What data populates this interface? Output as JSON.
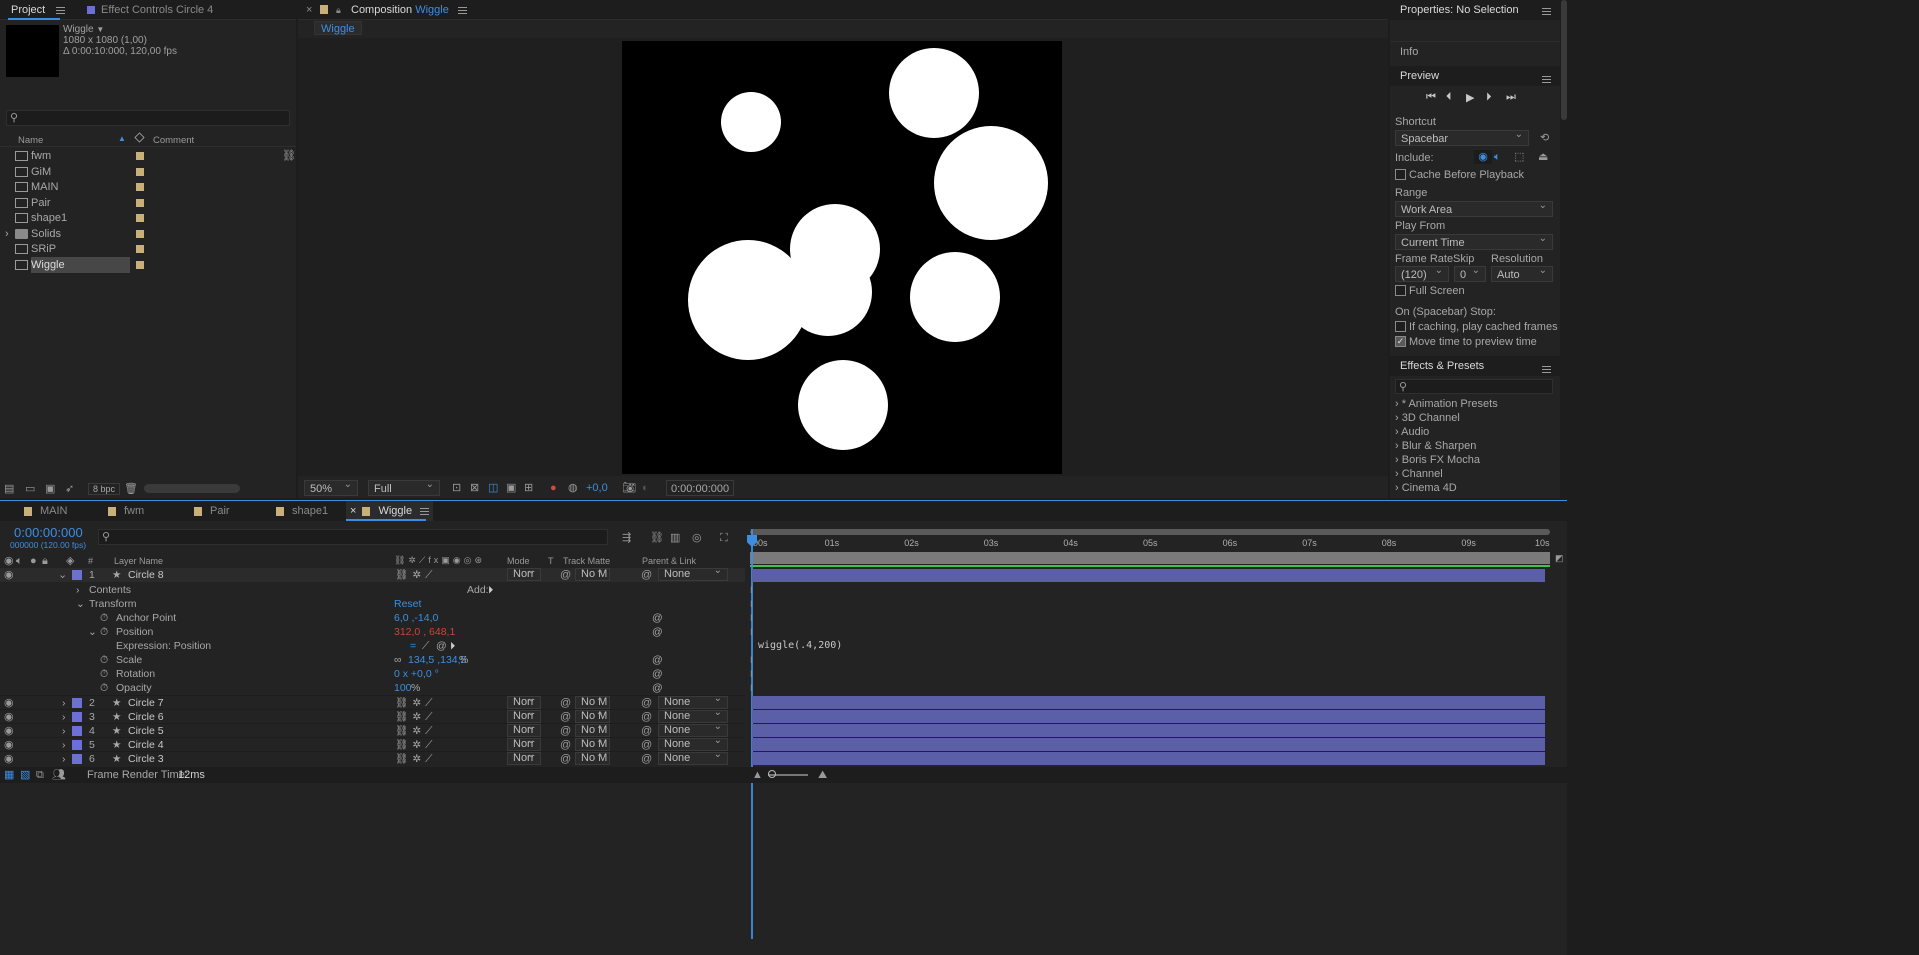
{
  "project": {
    "tab_project": "Project",
    "tab_effect_controls": "Effect Controls",
    "effect_target": "Circle 4",
    "comp_name": "Wiggle",
    "comp_size": "1080 x 1080 (1,00)",
    "comp_duration": "Δ 0:00:10:000, 120,00 fps",
    "col_name": "Name",
    "col_comment": "Comment",
    "items": [
      {
        "name": "fwm"
      },
      {
        "name": "GiM"
      },
      {
        "name": "MAIN"
      },
      {
        "name": "Pair"
      },
      {
        "name": "shape1"
      },
      {
        "name": "Solids"
      },
      {
        "name": "SRiP"
      },
      {
        "name": "Wiggle"
      }
    ],
    "bpc": "8 bpc"
  },
  "composition": {
    "tab_prefix": "Composition",
    "tab_name": "Wiggle",
    "sub_tab": "Wiggle",
    "zoom": "50%",
    "quality": "Full",
    "exposure": "+0,0",
    "timecode": "0:00:00:000"
  },
  "right": {
    "properties": "Properties: No Selection",
    "info": "Info",
    "preview": "Preview",
    "shortcut_label": "Shortcut",
    "shortcut_value": "Spacebar",
    "include_label": "Include:",
    "cache_before": "Cache Before Playback",
    "range_label": "Range",
    "range_value": "Work Area",
    "play_from_label": "Play From",
    "play_from_value": "Current Time",
    "frame_rate_label": "Frame Rate",
    "skip_label": "Skip",
    "resolution_label": "Resolution",
    "frame_rate_value": "(120)",
    "skip_value": "0",
    "resolution_value": "Auto",
    "full_screen": "Full Screen",
    "on_stop": "On (Spacebar) Stop:",
    "if_caching": "If caching, play cached frames",
    "move_time": "Move time to preview time",
    "effects_presets": "Effects & Presets",
    "effects": [
      "* Animation Presets",
      "3D Channel",
      "Audio",
      "Blur & Sharpen",
      "Boris FX Mocha",
      "Channel",
      "Cinema 4D"
    ]
  },
  "timeline": {
    "tabs": [
      "MAIN",
      "fwm",
      "Pair",
      "shape1",
      "Wiggle"
    ],
    "time": "0:00:00:000",
    "frames": "000000 (120.00 fps)",
    "col_layer_name": "Layer Name",
    "col_mode": "Mode",
    "col_t": "T",
    "col_track_matte": "Track Matte",
    "col_parent": "Parent & Link",
    "ruler": [
      "00s",
      "01s",
      "02s",
      "03s",
      "04s",
      "05s",
      "06s",
      "07s",
      "08s",
      "09s",
      "10s"
    ],
    "layer1": {
      "num": "1",
      "name": "Circle 8",
      "mode": "Norr",
      "matte": "No M",
      "parent": "None"
    },
    "contents": "Contents",
    "add": "Add:",
    "transform": "Transform",
    "reset": "Reset",
    "anchor_label": "Anchor Point",
    "anchor_value": "6,0 ,-14,0",
    "position_label": "Position",
    "position_value": "312,0 , 648,1",
    "expression_label": "Expression: Position",
    "expression": "wiggle(.4,200)",
    "scale_label": "Scale",
    "scale_value": "134,5 ,134,5",
    "scale_unit": "%",
    "rotation_label": "Rotation",
    "rotation_value": "0 x +0,0 °",
    "opacity_label": "Opacity",
    "opacity_value": "100",
    "opacity_unit": "%",
    "layers": [
      {
        "num": "2",
        "name": "Circle 7",
        "mode": "Norr",
        "matte": "No M",
        "parent": "None"
      },
      {
        "num": "3",
        "name": "Circle 6",
        "mode": "Norr",
        "matte": "No M",
        "parent": "None"
      },
      {
        "num": "4",
        "name": "Circle 5",
        "mode": "Norr",
        "matte": "No M",
        "parent": "None"
      },
      {
        "num": "5",
        "name": "Circle 4",
        "mode": "Norr",
        "matte": "No M",
        "parent": "None"
      },
      {
        "num": "6",
        "name": "Circle 3",
        "mode": "Norr",
        "matte": "No M",
        "parent": "None"
      }
    ],
    "render_time_label": "Frame Render Time:",
    "render_time": "12ms"
  },
  "colors": {
    "accent": "#3d8ee0",
    "layer_label": "#6b6fd6",
    "layer_bar": "#5b5fa8",
    "item_swatch": "#c9b07a",
    "expression_red": "#d0433a"
  }
}
